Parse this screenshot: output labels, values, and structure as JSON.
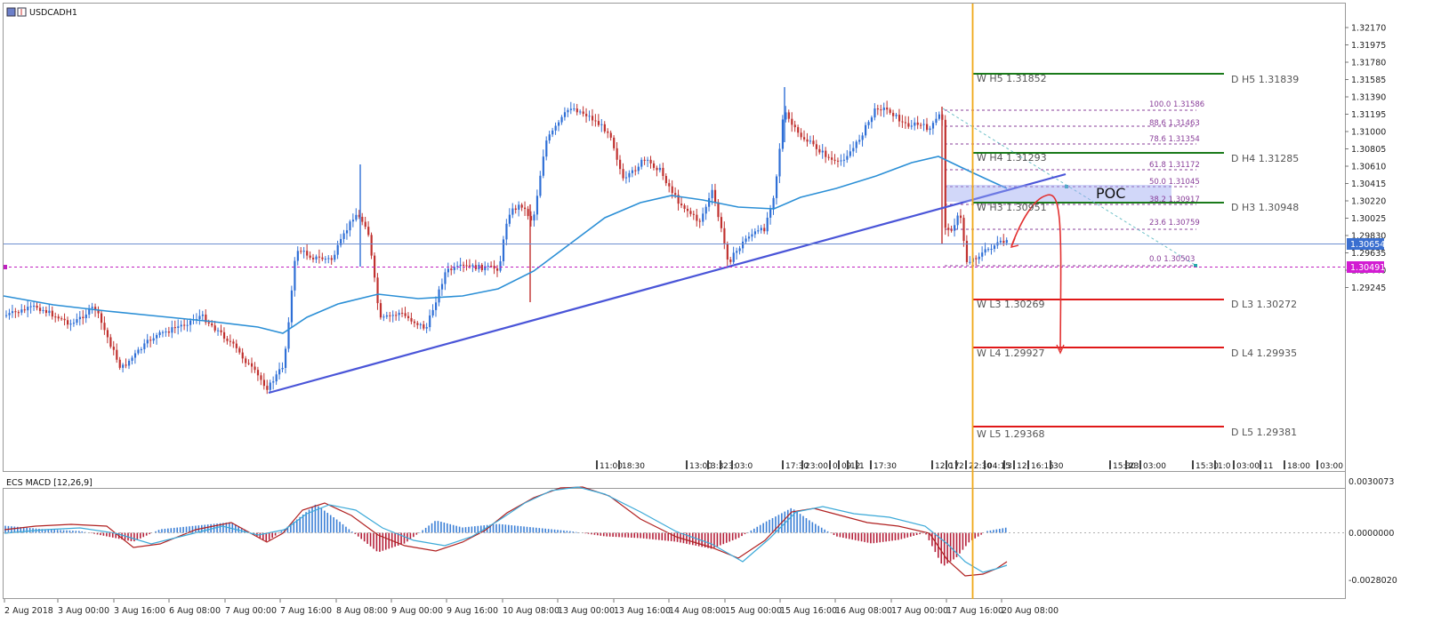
{
  "window": {
    "symbol_title": "USDCADH1",
    "indicator_title": "ECS MACD [12,26,9]"
  },
  "price_axis": {
    "ticks": [
      "1.32170",
      "1.31975",
      "1.31780",
      "1.31585",
      "1.31390",
      "1.31195",
      "1.31000",
      "1.30805",
      "1.30610",
      "1.30415",
      "1.30220",
      "1.30025",
      "1.29830",
      "1.29635",
      "1.29440",
      "1.29245"
    ],
    "current_price": "1.30654",
    "marked_price": "1.30491"
  },
  "macd_axis": {
    "ticks": [
      "0.0030073",
      "0.0000000",
      "-0.0028020"
    ]
  },
  "time_axis": {
    "ticks": [
      "2 Aug 2018",
      "3 Aug 00:00",
      "3 Aug 16:00",
      "6 Aug 08:00",
      "7 Aug 00:00",
      "7 Aug 16:00",
      "8 Aug 08:00",
      "9 Aug 00:00",
      "9 Aug 16:00",
      "10 Aug 08:00",
      "13 Aug 00:00",
      "13 Aug 16:00",
      "14 Aug 08:00",
      "15 Aug 00:00",
      "15 Aug 16:00",
      "16 Aug 08:00",
      "17 Aug 00:00",
      "17 Aug 16:00",
      "20 Aug 08:00"
    ]
  },
  "time_labels": [
    "11:00",
    "18:30",
    "13:00",
    "3:3",
    "23:",
    "03:0",
    "17:30",
    "23:00",
    "0",
    "09",
    "12",
    "1",
    "17:30",
    "12:0",
    "17",
    "2",
    "22:30",
    "04:15",
    "3",
    "12",
    "16:15",
    "30",
    "15:30",
    "23",
    "03:00",
    "15:30",
    "1:0",
    "03:00",
    "11",
    "18:00",
    "03:00"
  ],
  "levels": {
    "w_h5": "W  H5 1.31852",
    "d_h5": "D  H5 1.31839",
    "w_h4": "W  H4 1.31293",
    "d_h4": "D  H4 1.31285",
    "w_h3": "W  H3 1.30951",
    "d_h3": "D  H3 1.30948",
    "w_l3": "W  L3 1.30269",
    "d_l3": "D  L3 1.30272",
    "w_l4": "W  L4 1.29927",
    "d_l4": "D  L4 1.29935",
    "w_l5": "W  L5 1.29368",
    "d_l5": "D  L5 1.29381"
  },
  "fib_levels": [
    "100.0   1.31586",
    "88.6   1.31463",
    "78.6   1.31354",
    "61.8   1.31172",
    "50.0   1.31045",
    "38.2   1.30917",
    "23.6   1.30759",
    "0.0   1.30503"
  ],
  "poc_label": "POC",
  "colors": {
    "bull": "#2f6fd6",
    "bear": "#c0312f",
    "ma": "#2b8fd6",
    "trend": "#4a55d8",
    "vline": "#f0a818",
    "pivot_high": "#1a7a1a",
    "pivot_low": "#e01818",
    "fib": "#8a3f9a",
    "macd_pos": "#3b7fd6",
    "macd_neg": "#b5203a",
    "signal_red": "#b02020",
    "signal_blue": "#3ba9d8"
  }
}
